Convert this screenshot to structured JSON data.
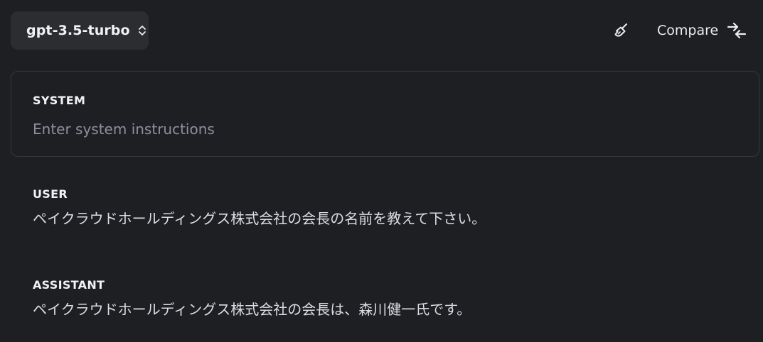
{
  "toolbar": {
    "model_label": "gpt-3.5-turbo",
    "compare_label": "Compare",
    "model_chevron_icon": "chevron-up-down-icon",
    "clear_icon": "broom-icon",
    "compare_icon": "compare-arrows-icon"
  },
  "system": {
    "label": "SYSTEM",
    "placeholder": "Enter system instructions",
    "value": ""
  },
  "messages": [
    {
      "role": "USER",
      "content": "ペイクラウドホールディングス株式会社の会長の名前を教えて下さい。"
    },
    {
      "role": "ASSISTANT",
      "content": "ペイクラウドホールディングス株式会社の会長は、森川健一氏です。"
    }
  ],
  "colors": {
    "background": "#1e1f22",
    "surface": "#2b2d31",
    "border": "#34363b",
    "text": "#ececf1",
    "placeholder": "#8e8ea0"
  }
}
